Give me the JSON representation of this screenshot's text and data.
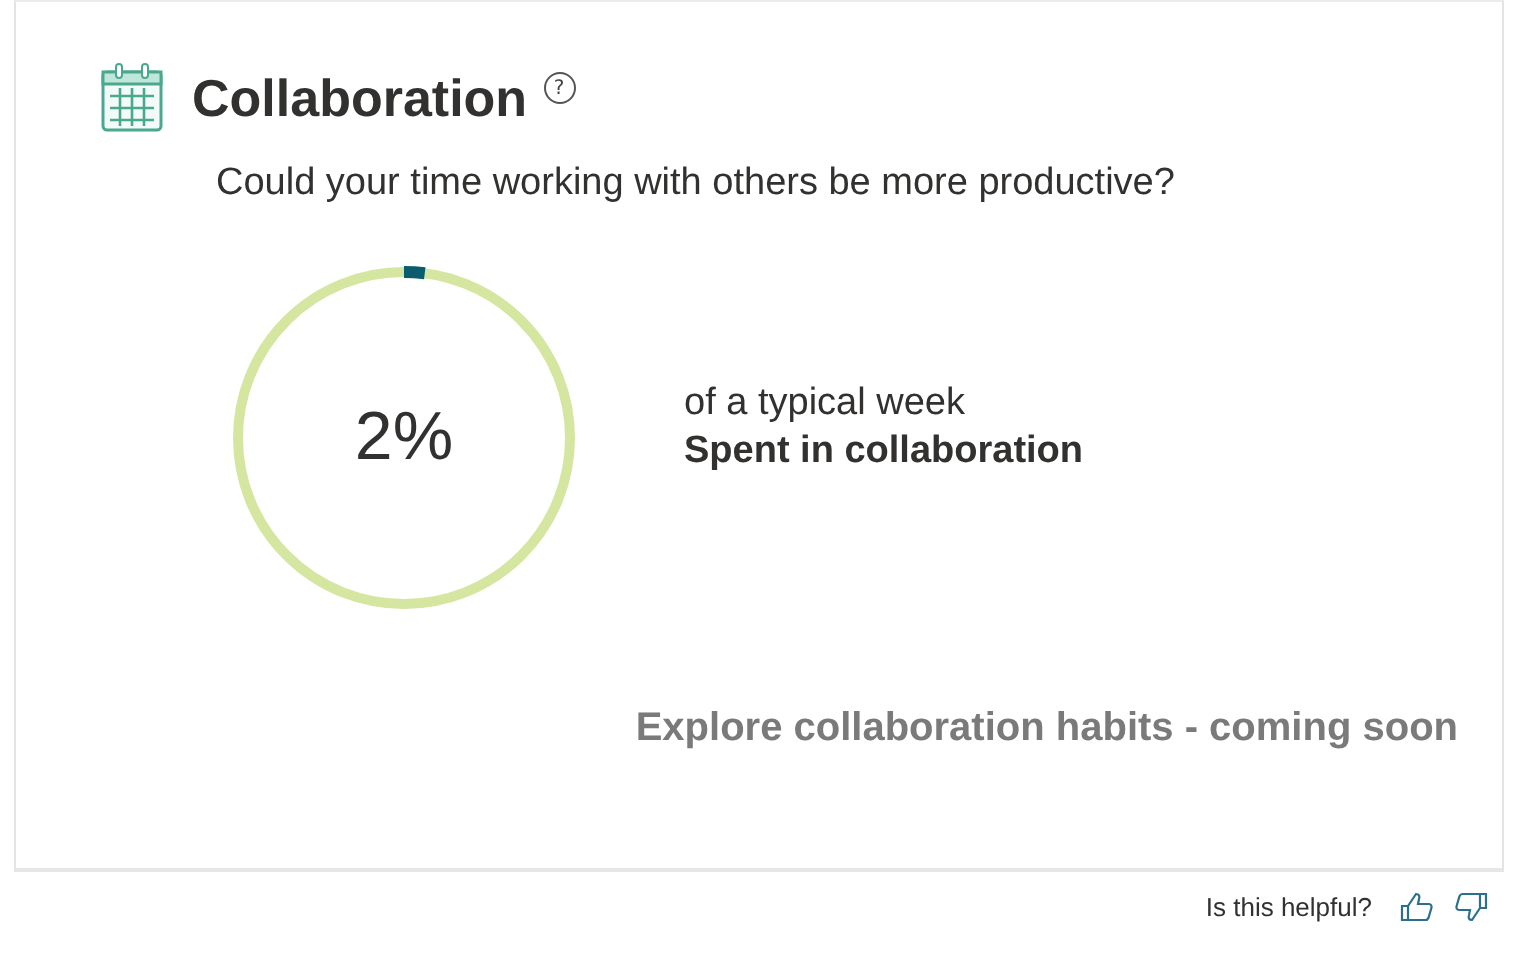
{
  "card": {
    "title": "Collaboration",
    "help_icon": "?",
    "question": "Could your time working with others be more productive?",
    "meter": {
      "level": 0.02,
      "value": "2%",
      "caption": "of a typical week",
      "label": "Spent in collaboration"
    },
    "link": "Explore collaboration habits - coming soon"
  },
  "feedback": {
    "prompt": "Is this helpful?"
  }
}
